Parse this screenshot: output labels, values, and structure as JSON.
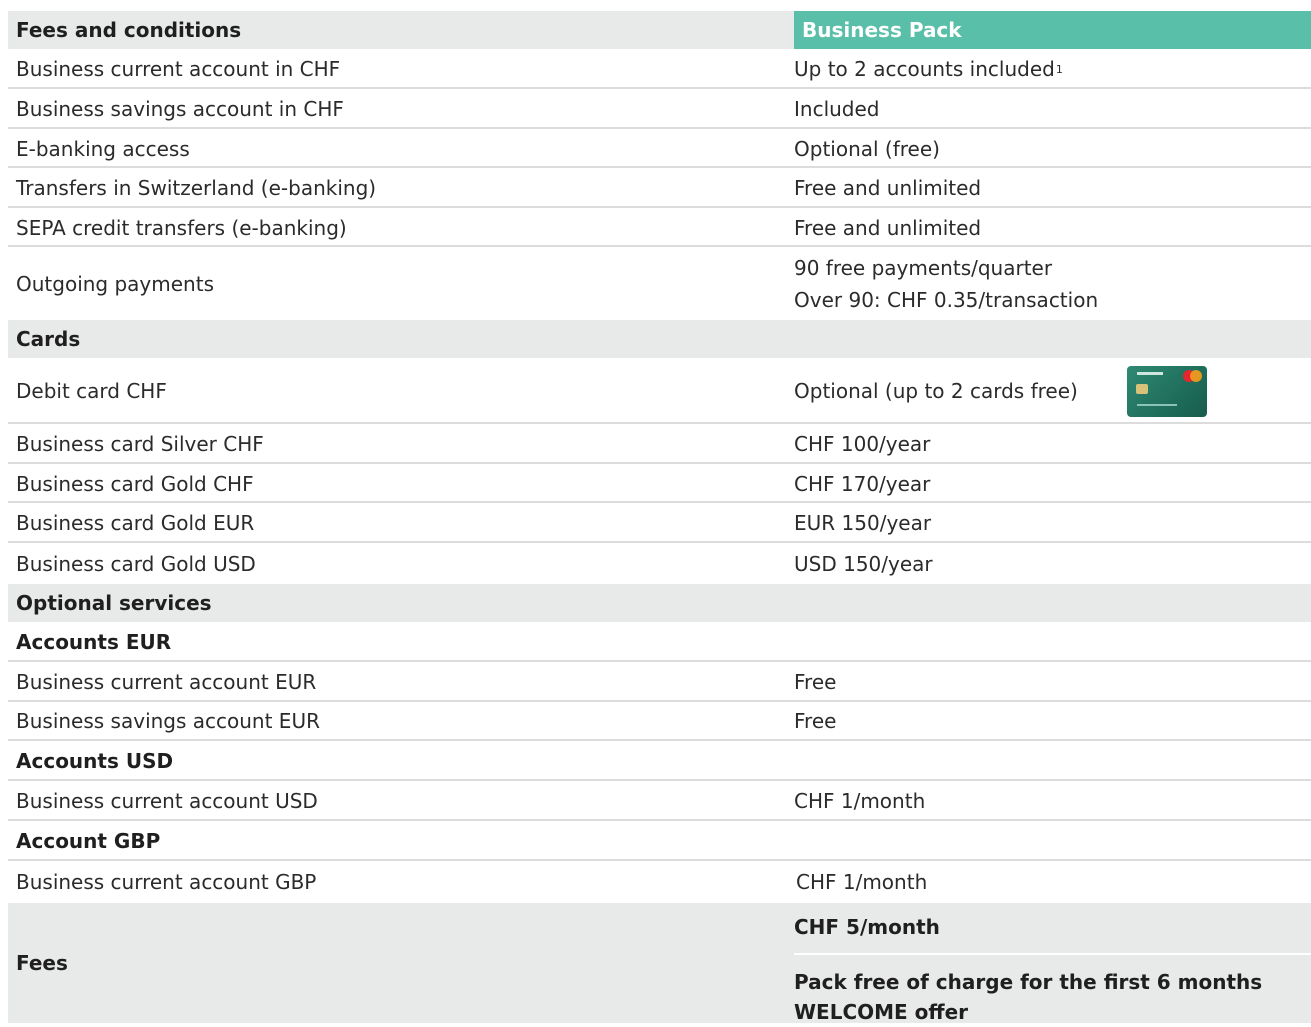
{
  "header": {
    "left": "Fees and conditions",
    "right": "Business Pack"
  },
  "rows_main": [
    {
      "label": "Business current account in CHF",
      "value": "Up to 2 accounts included",
      "sup": "1"
    },
    {
      "label": "Business savings account in CHF",
      "value": "Included"
    },
    {
      "label": "E-banking access",
      "value": "Optional (free)"
    },
    {
      "label": "Transfers in Switzerland (e-banking)",
      "value": "Free and unlimited"
    },
    {
      "label": "SEPA credit transfers (e-banking)",
      "value": "Free and unlimited"
    },
    {
      "label": "Outgoing payments",
      "value_line1": "90 free payments/quarter",
      "value_line2": "Over 90: CHF 0.35/transaction"
    }
  ],
  "cards_section": {
    "title": "Cards",
    "rows": [
      {
        "label": "Debit card CHF",
        "value": "Optional (up to 2 cards free)"
      },
      {
        "label": "Business card Silver CHF",
        "value": "CHF 100/year"
      },
      {
        "label": "Business card Gold CHF",
        "value": "CHF 170/year"
      },
      {
        "label": "Business card Gold EUR",
        "value": "EUR 150/year"
      },
      {
        "label": "Business card Gold USD",
        "value": "USD 150/year"
      }
    ]
  },
  "optional_section": {
    "title": "Optional services",
    "eur": {
      "title": "Accounts EUR",
      "rows": [
        {
          "label": "Business current account EUR",
          "value": "Free"
        },
        {
          "label": "Business savings account EUR",
          "value": "Free"
        }
      ]
    },
    "usd": {
      "title": "Accounts USD",
      "rows": [
        {
          "label": "Business current account USD",
          "value": "CHF 1/month"
        }
      ]
    },
    "gbp": {
      "title": "Account GBP",
      "rows": [
        {
          "label": "Business current account GBP",
          "value": "CHF 1/month"
        }
      ]
    }
  },
  "fees": {
    "label": "Fees",
    "price": "CHF 5/month",
    "offer_line1": "Pack free of charge for the first 6 months",
    "offer_line2": "WELCOME offer"
  },
  "icons": {
    "debit_card": "debit-card-image"
  },
  "colors": {
    "accent": "#5abfa8",
    "section_bg": "#e8e9e9",
    "divider": "#dcdcdc"
  }
}
